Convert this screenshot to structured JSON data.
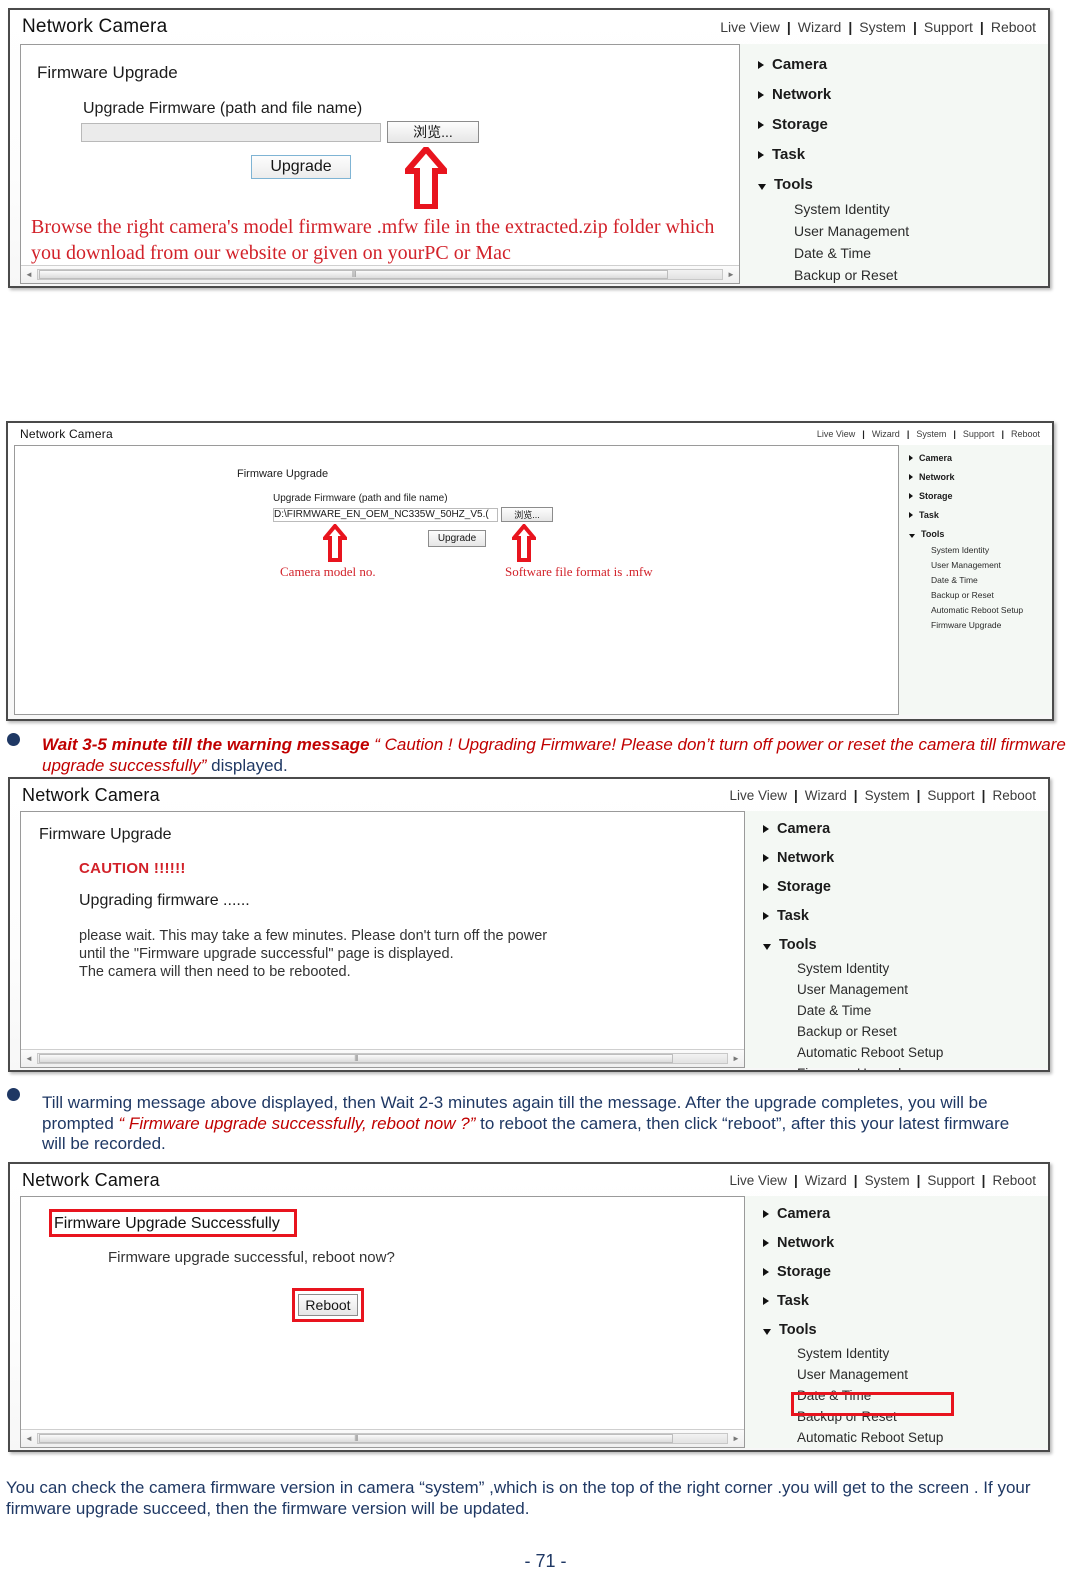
{
  "page": {
    "number": "- 71 -"
  },
  "ui_common": {
    "brand": "Network Camera",
    "nav": [
      "Live View",
      "Wizard",
      "System",
      "Support",
      "Reboot"
    ],
    "nav_separator": "|",
    "sidebar_top": [
      {
        "label": "Camera",
        "state": "collapsed"
      },
      {
        "label": "Network",
        "state": "collapsed"
      },
      {
        "label": "Storage",
        "state": "collapsed"
      },
      {
        "label": "Task",
        "state": "collapsed"
      },
      {
        "label": "Tools",
        "state": "expanded"
      }
    ],
    "sidebar_sub": [
      "System Identity",
      "User Management",
      "Date & Time",
      "Backup or Reset",
      "Automatic Reboot Setup",
      "Firmware Upgrade"
    ],
    "scrollbar": {
      "left_arrow": "◄",
      "right_arrow": "►",
      "grip": "III"
    }
  },
  "screenshot_1": {
    "page_title": "Firmware Upgrade",
    "field_label": "Upgrade Firmware (path and file name)",
    "path_value": "",
    "browse_button": "浏览...",
    "upgrade_button": "Upgrade",
    "annotation": "Browse the right camera's model firmware .mfw file in the extracted.zip folder which you download from our website or given on yourPC or Mac",
    "annotation_color": "#d2222a"
  },
  "screenshot_2": {
    "page_title": "Firmware Upgrade",
    "field_label": "Upgrade Firmware (path and file name)",
    "path_value": "D:\\FIRMWARE_EN_OEM_NC335W_50HZ_V5.(",
    "browse_button": "浏览...",
    "upgrade_button": "Upgrade",
    "annotation_left": "Camera model no.",
    "annotation_right": "Software file format is .mfw"
  },
  "screenshot_3": {
    "page_title": "Firmware Upgrade",
    "caution_heading": "CAUTION !!!!!!",
    "status_line": "Upgrading firmware ......",
    "body_lines": [
      "please wait. This may take a few minutes. Please don't turn off the power",
      "until the \"Firmware upgrade successful\" page is displayed.",
      "The camera will then need to be rebooted."
    ]
  },
  "screenshot_4": {
    "page_title": "Firmware Upgrade Successfully",
    "message": "Firmware upgrade successful, reboot now?",
    "reboot_button": "Reboot",
    "highlighted_sidebar_item": "Firmware Upgrade",
    "highlight_color": "#e8141e"
  },
  "paragraphs": {
    "p1": {
      "lead": "Wait 3-5 minute till the warning message",
      "quote_open": " “ ",
      "quoted": "Caution ! Upgrading Firmware! Please don’t turn off power or reset the camera till firmware upgrade successfully",
      "quote_close": "” ",
      "tail": "displayed."
    },
    "p2": {
      "part1": "Till warming message above displayed, then Wait 2-3 minutes again till the message. After the upgrade completes, you will be prompted ",
      "quoted": "“ Firmware upgrade successfully, reboot now ?”",
      "part2": " to reboot the camera, then click “reboot”, after this your latest firmware will be recorded."
    },
    "p3": {
      "text": "You can check the camera firmware version in camera “system” ,which is on the top of the right corner .you will get to the screen . If your firmware upgrade succeed, then the firmware version will be updated."
    }
  }
}
